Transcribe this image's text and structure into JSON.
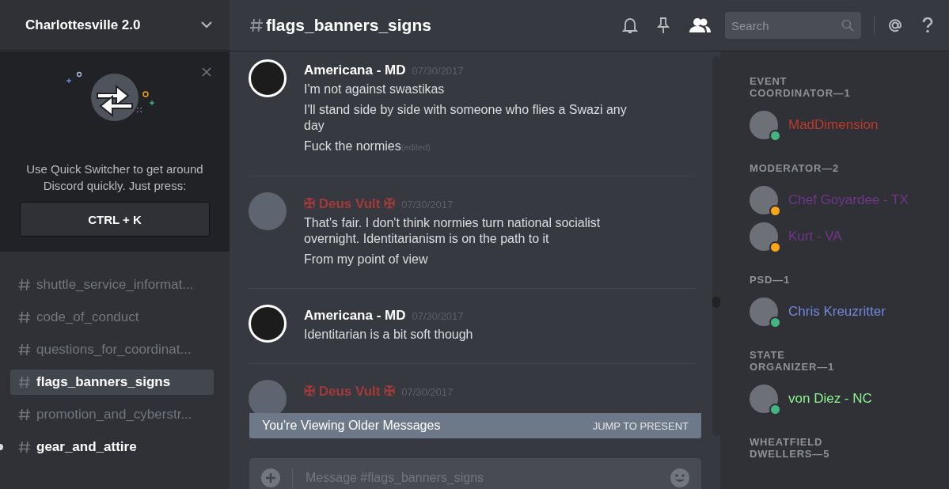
{
  "server": {
    "name": "Charlottesville 2.0"
  },
  "quick_switcher": {
    "text": "Use Quick Switcher to get around Discord quickly. Just press:",
    "shortcut": "CTRL + K"
  },
  "channels": [
    {
      "name": "shuttle_service_informat...",
      "selected": false,
      "unread": false
    },
    {
      "name": "code_of_conduct",
      "selected": false,
      "unread": false
    },
    {
      "name": "questions_for_coordinat...",
      "selected": false,
      "unread": false
    },
    {
      "name": "flags_banners_signs",
      "selected": true,
      "unread": false
    },
    {
      "name": "promotion_and_cyberstr...",
      "selected": false,
      "unread": false
    },
    {
      "name": "gear_and_attire",
      "selected": false,
      "unread": true
    }
  ],
  "header": {
    "channel": "flags_banners_signs",
    "search_placeholder": "Search"
  },
  "messages": [
    {
      "author": "Americana - MD",
      "color": "#ffffff",
      "timestamp": "07/30/2017",
      "lines": [
        {
          "text": "I'm not against swastikas",
          "edited": false
        },
        {
          "text": "I'll stand side by side with someone who flies a Swazi any day",
          "edited": false
        },
        {
          "text": "Fuck the normies",
          "edited": true
        }
      ]
    },
    {
      "author": "✠ Deus Vult ✠",
      "color": "#a33a3a",
      "timestamp": "07/30/2017",
      "lines": [
        {
          "text": "That's fair. I don't think normies turn national socialist overnight. Identitarianism is on the path to it",
          "edited": false
        },
        {
          "text": "From my point of view",
          "edited": false
        }
      ]
    },
    {
      "author": "Americana - MD",
      "color": "#ffffff",
      "timestamp": "07/30/2017",
      "lines": [
        {
          "text": "Identitarian is a bit soft though",
          "edited": false
        }
      ]
    },
    {
      "author": "✠ Deus Vult ✠",
      "color": "#a33a3a",
      "timestamp": "07/30/2017"
    }
  ],
  "edited_label": "(edited)",
  "older_banner": {
    "text": "You're Viewing Older Messages",
    "action": "JUMP TO PRESENT"
  },
  "composer": {
    "placeholder": "Message #flags_banners_signs"
  },
  "member_groups": [
    {
      "title": "EVENT COORDINATOR—1",
      "members": [
        {
          "name": "MadDimension",
          "color": "#c0392b",
          "idle": false
        }
      ]
    },
    {
      "title": "MODERATOR—2",
      "members": [
        {
          "name": "Chef Goyardee - TX",
          "color": "#71368a",
          "idle": true
        },
        {
          "name": "Kurt - VA",
          "color": "#71368a",
          "idle": true
        }
      ]
    },
    {
      "title": "PSD—1",
      "members": [
        {
          "name": "Chris Kreuzritter",
          "color": "#7289da",
          "idle": false
        }
      ]
    },
    {
      "title": "STATE ORGANIZER—1",
      "members": [
        {
          "name": "von Diez - NC",
          "color": "#8ef38e",
          "idle": false
        }
      ]
    },
    {
      "title": "WHEATFIELD DWELLERS—5"
    }
  ]
}
